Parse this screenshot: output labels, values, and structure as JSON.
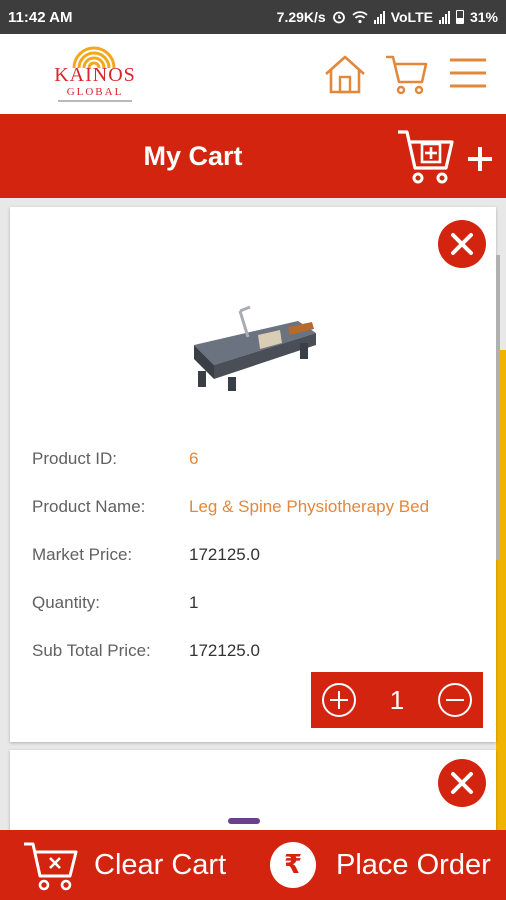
{
  "status_bar": {
    "time": "11:42 AM",
    "speed": "7.29K/s",
    "network": "VoLTE",
    "battery": "31%"
  },
  "header": {
    "logo_brand": "KAINOS",
    "logo_sub": "GLOBAL"
  },
  "cart_bar": {
    "title": "My Cart"
  },
  "product": {
    "rows": [
      {
        "label": "Product ID:",
        "value": "6"
      },
      {
        "label": "Product Name:",
        "value": "Leg & Spine Physiotherapy Bed"
      },
      {
        "label": "Market Price:",
        "value": "172125.0"
      },
      {
        "label": "Quantity:",
        "value": "1"
      },
      {
        "label": "Sub Total Price:",
        "value": "172125.0"
      }
    ],
    "stepper_qty": "1"
  },
  "bottom_bar": {
    "clear_label": "Clear Cart",
    "order_label": "Place Order",
    "rupee_symbol": "₹"
  },
  "colors": {
    "primary_red": "#d2240f",
    "accent_orange": "#e3873a",
    "edge_yellow": "#f0b400"
  }
}
